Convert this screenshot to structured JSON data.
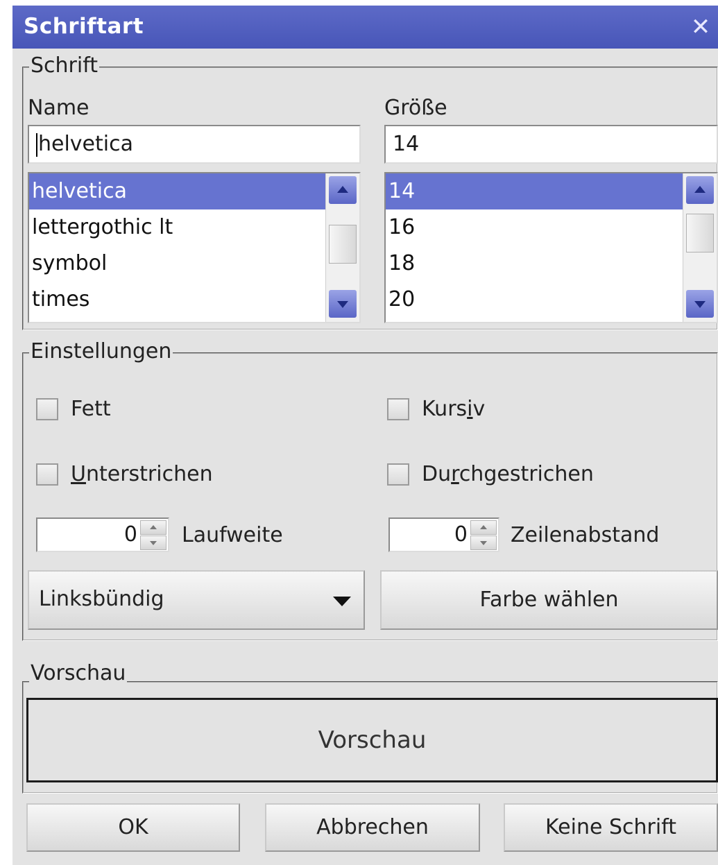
{
  "window": {
    "title": "Schriftart"
  },
  "font_group": {
    "legend": "Schrift",
    "name": {
      "label": "Name",
      "value": "helvetica",
      "items": [
        "helvetica",
        "lettergothic lt",
        "symbol",
        "times"
      ],
      "selected": "helvetica"
    },
    "size": {
      "label": "Größe",
      "value": "14",
      "items": [
        "14",
        "16",
        "18",
        "20"
      ],
      "selected": "14"
    }
  },
  "settings_group": {
    "legend": "Einstellungen",
    "bold": {
      "label": "Fett",
      "checked": false
    },
    "italic": {
      "label_before": "Kurs",
      "mnemonic": "i",
      "label_after": "v",
      "checked": false
    },
    "underline": {
      "label_before": "",
      "mnemonic": "U",
      "label_after": "nterstrichen",
      "checked": false
    },
    "strikethrough": {
      "label_before": "Du",
      "mnemonic": "r",
      "label_after": "chgestrichen",
      "checked": false
    },
    "spacing": {
      "value": "0",
      "label": "Laufweite"
    },
    "line_spacing": {
      "value": "0",
      "label": "Zeilenabstand"
    },
    "alignment": {
      "selected": "Linksbündig"
    },
    "color_button": "Farbe wählen"
  },
  "preview_group": {
    "legend": "Vorschau",
    "sample_text": "Vorschau"
  },
  "buttons": {
    "ok": "OK",
    "cancel": "Abbrechen",
    "no_font": "Keine Schrift"
  },
  "colors": {
    "title_bar": "#4f5cbd",
    "selection": "#6673d0",
    "dialog_bg": "#e3e3e3"
  }
}
